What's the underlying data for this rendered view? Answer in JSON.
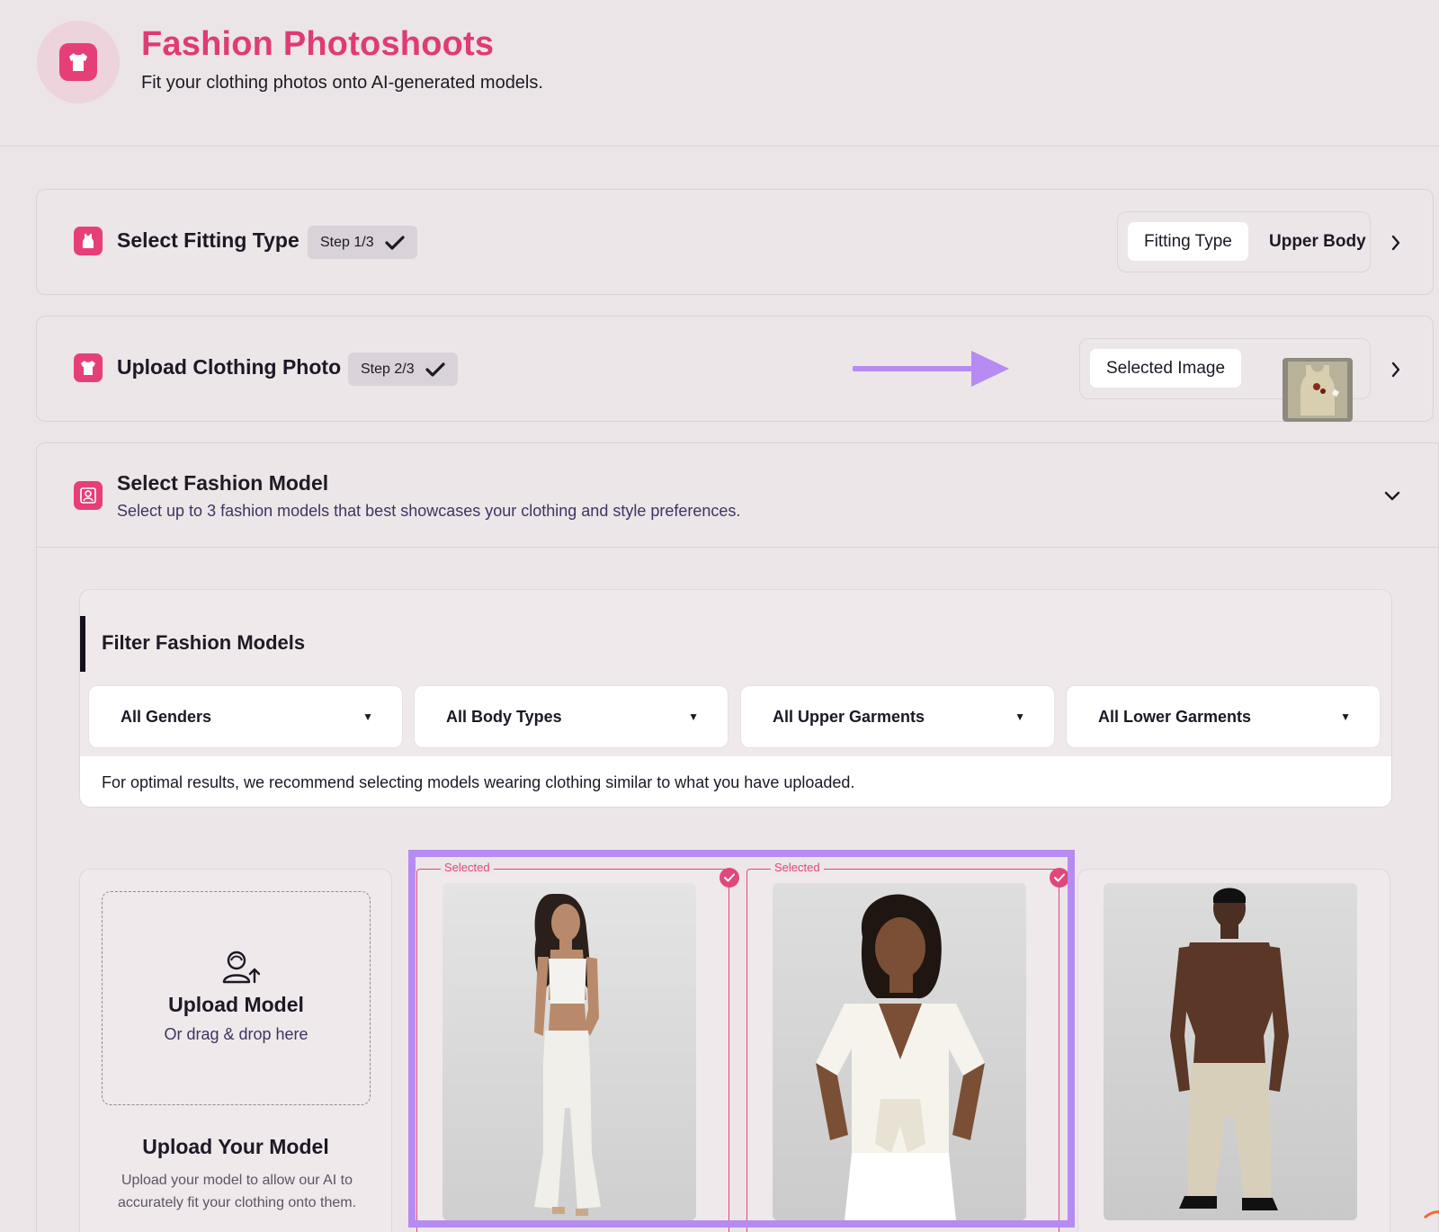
{
  "header": {
    "title": "Fashion Photoshoots",
    "subtitle": "Fit your clothing photos onto AI-generated models."
  },
  "steps": [
    {
      "title": "Select Fitting Type",
      "badge": "Step 1/3",
      "summary_label": "Fitting Type",
      "summary_value": "Upper Body"
    },
    {
      "title": "Upload Clothing Photo",
      "badge": "Step 2/3",
      "summary_label": "Selected Image"
    },
    {
      "title": "Select Fashion Model",
      "description": "Select up to 3 fashion models that best showcases your clothing and style preferences."
    }
  ],
  "filters": {
    "title": "Filter Fashion Models",
    "selects": [
      "All Genders",
      "All Body Types",
      "All Upper Garments",
      "All Lower Garments"
    ],
    "note": "For optimal results, we recommend selecting models wearing clothing similar to what you have uploaded."
  },
  "upload": {
    "label": "Upload Model",
    "sub": "Or drag & drop here",
    "heading": "Upload Your Model",
    "description": "Upload your model to allow our AI to accurately fit your clothing onto them."
  },
  "models": [
    {
      "selected": true,
      "selected_label": "Selected"
    },
    {
      "selected": true,
      "selected_label": "Selected"
    },
    {
      "selected": false
    }
  ],
  "colors": {
    "accent": "#e63f78",
    "annotation": "#b68bf2",
    "background": "#ebe5e8"
  }
}
